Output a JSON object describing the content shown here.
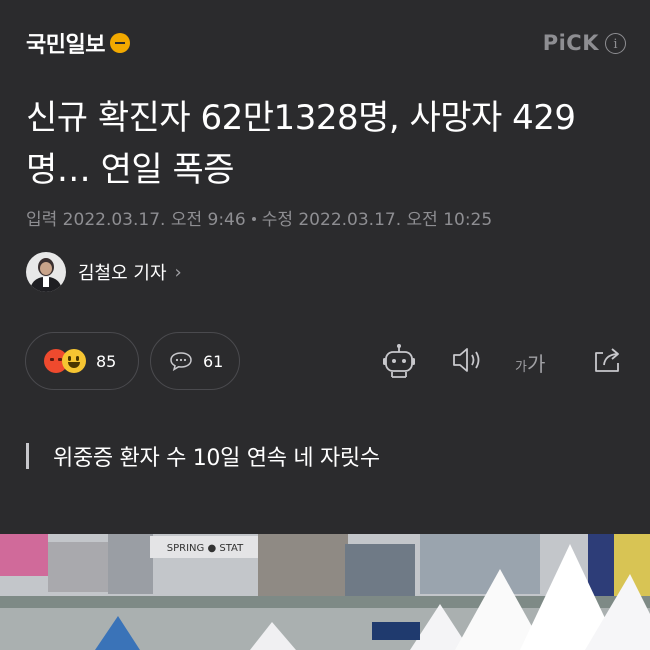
{
  "header": {
    "brand": "국민일보",
    "pick_label": "PiCK",
    "info_glyph": "i"
  },
  "article": {
    "title": "신규 확진자 62만1328명, 사망자 429명… 연일 폭증",
    "published": "입력 2022.03.17. 오전 9:46",
    "modified": "수정 2022.03.17. 오전 10:25",
    "author": "김철오 기자",
    "author_chevron": "›",
    "reactions_count": "85",
    "comments_count": "61",
    "font_small": "가",
    "font_big": "가",
    "subheading": "위중증 환자 수 10일 연속 네 자릿수"
  },
  "photo": {
    "sign_text": "SPRING ● STAT"
  },
  "colors": {
    "background": "#2b2b2d",
    "text": "#ffffff",
    "muted": "#8e8e92",
    "brand_accent": "#f2a900",
    "angry": "#ef4a2e",
    "happy": "#f6c532"
  },
  "icons": [
    "brand-logo-icon",
    "info-icon",
    "avatar",
    "angry-emoji-icon",
    "happy-emoji-icon",
    "comment-bubble-icon",
    "robot-icon",
    "speaker-icon",
    "font-size-icon",
    "share-icon",
    "chevron-right-icon"
  ]
}
